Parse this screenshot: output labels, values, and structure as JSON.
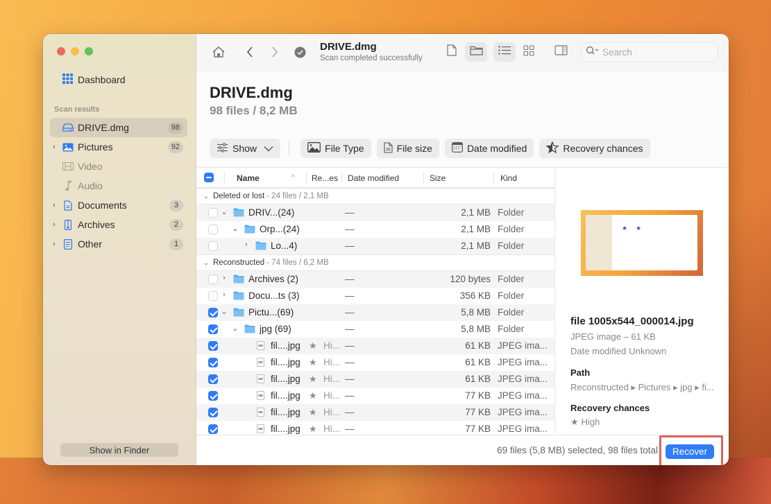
{
  "sidebar": {
    "dashboard_label": "Dashboard",
    "section_label": "Scan results",
    "items": [
      {
        "label": "DRIVE.dmg",
        "count": "98",
        "icon": "drive-icon"
      },
      {
        "label": "Pictures",
        "count": "92",
        "icon": "pictures-icon"
      },
      {
        "label": "Video",
        "count": "",
        "icon": "video-icon"
      },
      {
        "label": "Audio",
        "count": "",
        "icon": "audio-icon"
      },
      {
        "label": "Documents",
        "count": "3",
        "icon": "documents-icon"
      },
      {
        "label": "Archives",
        "count": "2",
        "icon": "archives-icon"
      },
      {
        "label": "Other",
        "count": "1",
        "icon": "other-icon"
      }
    ],
    "show_in_finder": "Show in Finder"
  },
  "toolbar": {
    "title": "DRIVE.dmg",
    "subtitle": "Scan completed successfully",
    "search_placeholder": "Search"
  },
  "header": {
    "title": "DRIVE.dmg",
    "summary": "98 files / 8,2 MB"
  },
  "filters": {
    "show": "Show",
    "file_type": "File Type",
    "file_size": "File size",
    "date_modified": "Date modified",
    "recovery_chances": "Recovery chances"
  },
  "table": {
    "columns": {
      "name": "Name",
      "recovery": "Re...es",
      "date": "Date modified",
      "size": "Size",
      "kind": "Kind"
    },
    "groups": [
      {
        "label": "Deleted or lost",
        "stat": "- 24 files / 2,1 MB"
      },
      {
        "label": "Reconstructed",
        "stat": "- 74 files / 6,2 MB"
      }
    ],
    "rows_group1": [
      {
        "name": "DRIV...(24)",
        "date": "—",
        "size": "2,1 MB",
        "kind": "Folder"
      },
      {
        "name": "Orp...(24)",
        "date": "—",
        "size": "2,1 MB",
        "kind": "Folder"
      },
      {
        "name": "Lo...4)",
        "date": "—",
        "size": "2,1 MB",
        "kind": "Folder"
      }
    ],
    "rows_group2": [
      {
        "name": "Archives (2)",
        "date": "—",
        "size": "120 bytes",
        "kind": "Folder"
      },
      {
        "name": "Docu...ts (3)",
        "date": "—",
        "size": "356 KB",
        "kind": "Folder"
      },
      {
        "name": "Pictu...(69)",
        "date": "—",
        "size": "5,8 MB",
        "kind": "Folder"
      },
      {
        "name": "jpg (69)",
        "date": "—",
        "size": "5,8 MB",
        "kind": "Folder"
      },
      {
        "name": "fil....jpg",
        "recovery": "Hi...",
        "date": "—",
        "size": "61 KB",
        "kind": "JPEG ima..."
      },
      {
        "name": "fil....jpg",
        "recovery": "Hi...",
        "date": "—",
        "size": "61 KB",
        "kind": "JPEG ima..."
      },
      {
        "name": "fil....jpg",
        "recovery": "Hi...",
        "date": "—",
        "size": "61 KB",
        "kind": "JPEG ima..."
      },
      {
        "name": "fil....jpg",
        "recovery": "Hi...",
        "date": "—",
        "size": "77 KB",
        "kind": "JPEG ima..."
      },
      {
        "name": "fil....jpg",
        "recovery": "Hi...",
        "date": "—",
        "size": "77 KB",
        "kind": "JPEG ima..."
      },
      {
        "name": "fil....jpg",
        "recovery": "Hi...",
        "date": "—",
        "size": "77 KB",
        "kind": "JPEG ima..."
      }
    ]
  },
  "detail": {
    "filename": "file 1005x544_000014.jpg",
    "type": "JPEG image – 61 KB",
    "date_label": "Date modified",
    "date_value": "Unknown",
    "path_label": "Path",
    "path_value": "Reconstructed ▸ Pictures ▸ jpg ▸ fi...",
    "recovery_label": "Recovery chances",
    "recovery_value": "High"
  },
  "footer": {
    "status": "69 files (5,8 MB) selected, 98 files total",
    "recover": "Recover"
  },
  "colors": {
    "accent": "#2f7cf6",
    "highlight": "#e0625a",
    "sidebar_bg": "#ebe3c6"
  }
}
